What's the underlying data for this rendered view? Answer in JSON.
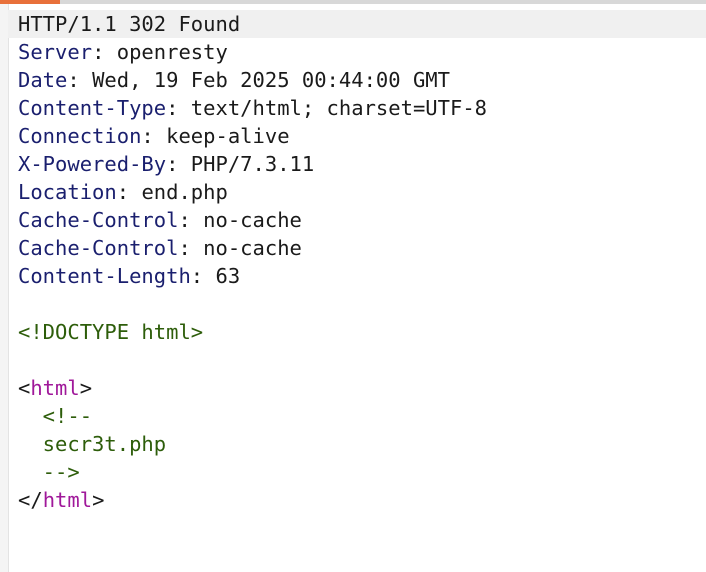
{
  "response": {
    "status_line": "HTTP/1.1 302 Found",
    "headers": [
      {
        "name": "Server",
        "value": "openresty"
      },
      {
        "name": "Date",
        "value": "Wed, 19 Feb 2025 00:44:00 GMT"
      },
      {
        "name": "Content-Type",
        "value": "text/html; charset=UTF-8"
      },
      {
        "name": "Connection",
        "value": "keep-alive"
      },
      {
        "name": "X-Powered-By",
        "value": "PHP/7.3.11"
      },
      {
        "name": "Location",
        "value": "end.php"
      },
      {
        "name": "Cache-Control",
        "value": "no-cache"
      },
      {
        "name": "Cache-Control",
        "value": "no-cache"
      },
      {
        "name": "Content-Length",
        "value": "63"
      }
    ],
    "header_separator": ": ",
    "body": {
      "doctype": "<!DOCTYPE html>",
      "open_tag_lt": "<",
      "open_tag_name": "html",
      "open_tag_gt": ">",
      "comment_open": "  <!--",
      "comment_text": "  secr3t.php",
      "comment_close": "  -->",
      "close_tag_lt": "</",
      "close_tag_name": "html",
      "close_tag_gt": ">"
    }
  },
  "colors": {
    "header_key": "#1a1f6e",
    "doctype": "#2d5d0a",
    "tag_name": "#a0189a",
    "comment": "#2d5d0a",
    "accent": "#e8703a"
  }
}
